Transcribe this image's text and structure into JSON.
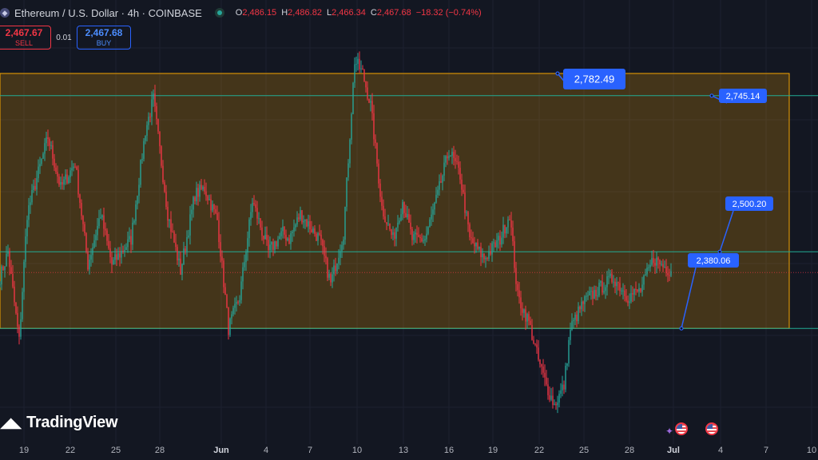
{
  "header": {
    "title": "Ethereum / U.S. Dollar · 4h · COINBASE",
    "ohlc": {
      "o_label": "O",
      "o_value": "2,486.15",
      "h_label": "H",
      "h_value": "2,486.82",
      "l_label": "L",
      "l_value": "2,466.34",
      "c_label": "C",
      "c_value": "2,467.68",
      "change": "−18.32 (−0.74%)"
    }
  },
  "trade": {
    "sell_price": "2,467.67",
    "sell_label": "SELL",
    "spread": "0.01",
    "buy_price": "2,467.68",
    "buy_label": "BUY"
  },
  "branding": {
    "logo_text": "TradingView"
  },
  "icons": [
    "ethereum-icon",
    "market-status-icon",
    "us-flag-icon",
    "plus-sparkle-icon"
  ],
  "colors": {
    "background": "#131722",
    "up": "#26a69a",
    "down": "#f23645",
    "range_box": "#f7a600",
    "line": "#22ab94",
    "label": "#2962ff"
  },
  "chart_data": {
    "type": "candlestick",
    "timeframe": "4h",
    "symbol": "ETHUSD",
    "x_tick_labels": [
      "19",
      "22",
      "25",
      "28",
      "Jun",
      "4",
      "7",
      "10",
      "13",
      "16",
      "19",
      "22",
      "25",
      "28",
      "Jul",
      "4",
      "7",
      "10"
    ],
    "approx_ylim": [
      2220,
      2880
    ],
    "approx_pivots": [
      {
        "t": 0,
        "p": 2460
      },
      {
        "t": 5,
        "p": 2500
      },
      {
        "t": 12,
        "p": 2360
      },
      {
        "t": 17,
        "p": 2560
      },
      {
        "t": 30,
        "p": 2680
      },
      {
        "t": 38,
        "p": 2600
      },
      {
        "t": 47,
        "p": 2640
      },
      {
        "t": 55,
        "p": 2480
      },
      {
        "t": 63,
        "p": 2560
      },
      {
        "t": 70,
        "p": 2480
      },
      {
        "t": 82,
        "p": 2520
      },
      {
        "t": 91,
        "p": 2690
      },
      {
        "t": 96,
        "p": 2740
      },
      {
        "t": 105,
        "p": 2560
      },
      {
        "t": 113,
        "p": 2470
      },
      {
        "t": 122,
        "p": 2590
      },
      {
        "t": 128,
        "p": 2600
      },
      {
        "t": 136,
        "p": 2550
      },
      {
        "t": 143,
        "p": 2380
      },
      {
        "t": 150,
        "p": 2430
      },
      {
        "t": 158,
        "p": 2580
      },
      {
        "t": 168,
        "p": 2500
      },
      {
        "t": 177,
        "p": 2530
      },
      {
        "t": 181,
        "p": 2520
      },
      {
        "t": 188,
        "p": 2560
      },
      {
        "t": 200,
        "p": 2520
      },
      {
        "t": 207,
        "p": 2450
      },
      {
        "t": 215,
        "p": 2530
      },
      {
        "t": 222,
        "p": 2800
      },
      {
        "t": 227,
        "p": 2780
      },
      {
        "t": 232,
        "p": 2730
      },
      {
        "t": 239,
        "p": 2570
      },
      {
        "t": 246,
        "p": 2520
      },
      {
        "t": 252,
        "p": 2580
      },
      {
        "t": 258,
        "p": 2520
      },
      {
        "t": 266,
        "p": 2520
      },
      {
        "t": 274,
        "p": 2590
      },
      {
        "t": 281,
        "p": 2660
      },
      {
        "t": 288,
        "p": 2620
      },
      {
        "t": 294,
        "p": 2520
      },
      {
        "t": 303,
        "p": 2490
      },
      {
        "t": 313,
        "p": 2520
      },
      {
        "t": 319,
        "p": 2560
      },
      {
        "t": 324,
        "p": 2430
      },
      {
        "t": 331,
        "p": 2390
      },
      {
        "t": 337,
        "p": 2330
      },
      {
        "t": 342,
        "p": 2290
      },
      {
        "t": 347,
        "p": 2260
      },
      {
        "t": 353,
        "p": 2290
      },
      {
        "t": 357,
        "p": 2380
      },
      {
        "t": 365,
        "p": 2420
      },
      {
        "t": 374,
        "p": 2440
      },
      {
        "t": 384,
        "p": 2460
      },
      {
        "t": 393,
        "p": 2430
      },
      {
        "t": 401,
        "p": 2440
      },
      {
        "t": 409,
        "p": 2490
      },
      {
        "t": 414,
        "p": 2480
      },
      {
        "t": 420,
        "p": 2470
      }
    ],
    "drawings": {
      "range_box": {
        "top_price": 2782.49,
        "bottom_price": 2380.06
      },
      "horizontal_lines": [
        2745.14,
        2500.2,
        2380.06
      ],
      "price_labels": [
        "2,782.49",
        "2,745.14",
        "2,500.20",
        "2,380.06"
      ],
      "current_price": 2467.68
    },
    "xlabel": "",
    "ylabel": ""
  }
}
